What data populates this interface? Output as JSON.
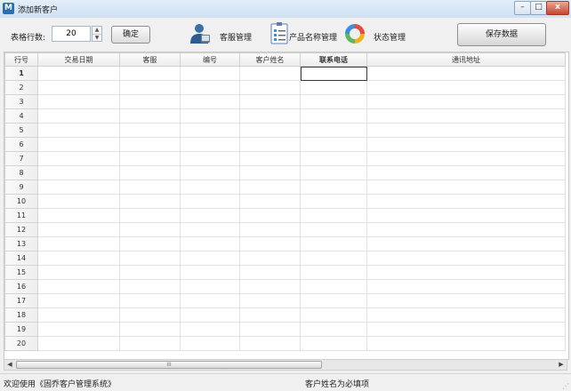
{
  "window": {
    "title": "添加新客户",
    "minimize": "–",
    "maximize": "□",
    "close": "x"
  },
  "toolbar": {
    "rows_label": "表格行数:",
    "rows_value": "20",
    "confirm_label": "确定",
    "tools": [
      {
        "label": "客服管理",
        "icon": "customer-service-icon"
      },
      {
        "label": "产品名称管理",
        "icon": "product-list-icon"
      },
      {
        "label": "状态管理",
        "icon": "status-cycle-icon"
      }
    ],
    "save_label": "保存数据"
  },
  "grid": {
    "headers": [
      "行号",
      "交易日期",
      "客服",
      "编号",
      "客户姓名",
      "联系电话",
      "通讯地址"
    ],
    "row_numbers": [
      "1",
      "2",
      "3",
      "4",
      "5",
      "6",
      "7",
      "8",
      "9",
      "10",
      "11",
      "12",
      "13",
      "14",
      "15",
      "16",
      "17",
      "18",
      "19",
      "20"
    ],
    "selected_row": 1,
    "selected_column": "联系电话",
    "scroll_thumb_label": "III"
  },
  "status": {
    "left": "欢迎使用《固乔客户管理系统》",
    "right": "客户姓名为必填项",
    "grip": "⋰"
  }
}
